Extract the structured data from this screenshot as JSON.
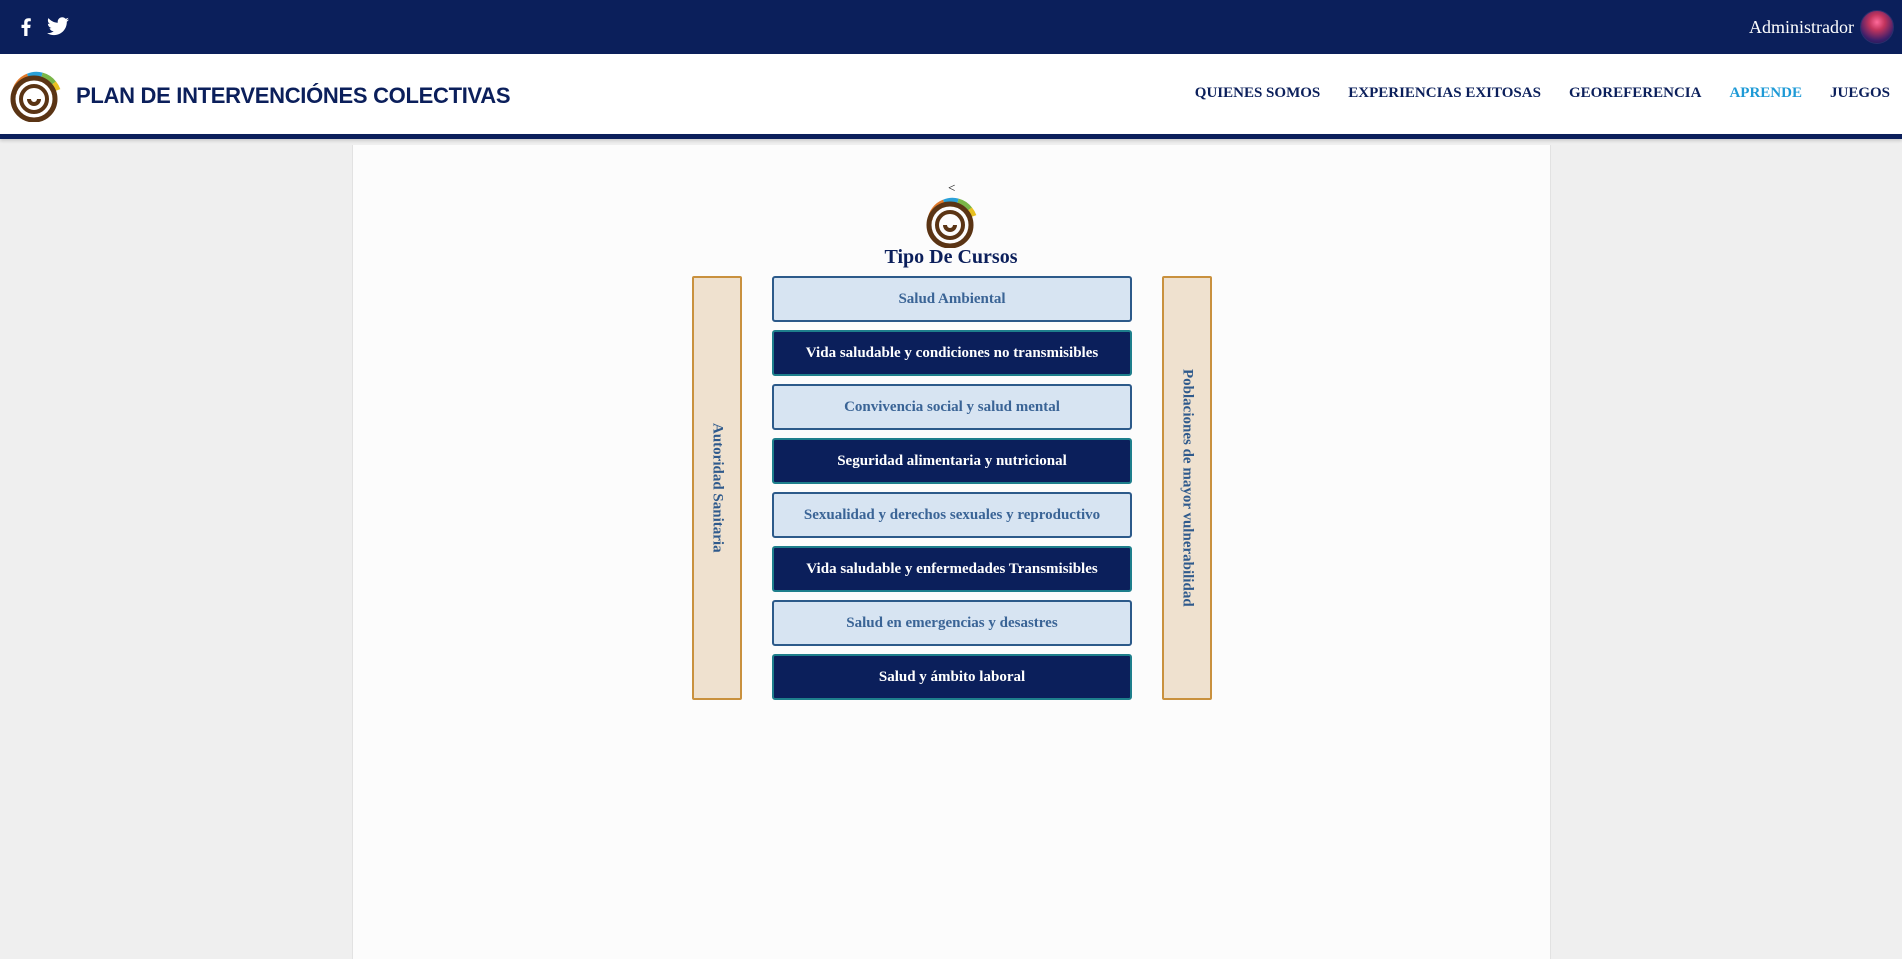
{
  "topbar": {
    "social": [
      {
        "name": "facebook-icon"
      },
      {
        "name": "twitter-icon"
      }
    ],
    "user_label": "Administrador"
  },
  "header": {
    "brand_title": "PLAN DE INTERVENCIÓNES COLECTIVAS",
    "nav": [
      {
        "label": "QUIENES SOMOS",
        "active": false
      },
      {
        "label": "EXPERIENCIAS EXITOSAS",
        "active": false
      },
      {
        "label": "GEOREFERENCIA",
        "active": false
      },
      {
        "label": "APRENDE",
        "active": true
      },
      {
        "label": "JUEGOS",
        "active": false
      }
    ]
  },
  "main": {
    "caret": "<",
    "heading": "Tipo De Cursos",
    "left_panel_label": "Autoridad Sanitaria",
    "right_panel_label": "Poblaciones de mayor vulnerabilidad",
    "courses": [
      {
        "label": "Salud Ambiental",
        "style": "light"
      },
      {
        "label": "Vida saludable y condiciones no transmisibles",
        "style": "dark"
      },
      {
        "label": "Convivencia social y salud mental",
        "style": "light"
      },
      {
        "label": "Seguridad alimentaria y nutricional",
        "style": "dark"
      },
      {
        "label": "Sexualidad y derechos sexuales y reproductivo",
        "style": "light"
      },
      {
        "label": "Vida saludable y enfermedades Transmisibles",
        "style": "dark"
      },
      {
        "label": "Salud en emergencias y desastres",
        "style": "light"
      },
      {
        "label": "Salud y ámbito laboral",
        "style": "dark"
      }
    ]
  },
  "colors": {
    "navy": "#0b1f5b",
    "accent_active": "#1e9ad6",
    "light_button_bg": "#d7e4f2",
    "side_panel_bg": "#efe1cf",
    "side_panel_border": "#c9913e"
  }
}
